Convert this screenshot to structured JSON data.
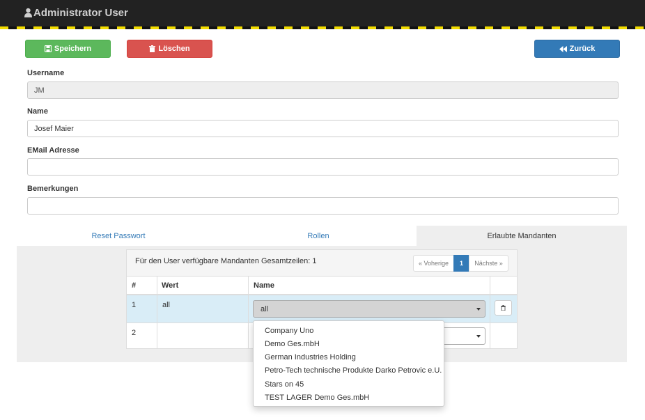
{
  "header": {
    "title": "Administrator User"
  },
  "toolbar": {
    "save_label": "Speichern",
    "delete_label": "Löschen",
    "back_label": "Zurück"
  },
  "form": {
    "username_label": "Username",
    "username_value": "JM",
    "name_label": "Name",
    "name_value": "Josef Maier",
    "email_label": "EMail Adresse",
    "email_value": "",
    "remarks_label": "Bemerkungen",
    "remarks_value": ""
  },
  "tabs": [
    {
      "label": "Reset Passwort",
      "active": false
    },
    {
      "label": "Rollen",
      "active": false
    },
    {
      "label": "Erlaubte Mandanten",
      "active": true
    }
  ],
  "mandanten": {
    "summary": "Für den User verfügbare Mandanten Gesamtzeilen: 1",
    "pager": {
      "prev": "« Voherige",
      "current": "1",
      "next": "Nächste »"
    },
    "columns": [
      "#",
      "Wert",
      "Name"
    ],
    "rows": [
      {
        "num": "1",
        "wert": "all",
        "name": "all"
      },
      {
        "num": "2",
        "wert": "",
        "name": ""
      }
    ],
    "dropdown_options": [
      "Company Uno",
      "Demo Ges.mbH",
      "German Industries Holding",
      "Petro-Tech technische Produkte Darko Petrovic e.U.",
      "Stars on 45",
      "TEST LAGER Demo Ges.mbH"
    ]
  },
  "colors": {
    "save": "#5cb85c",
    "delete": "#d9534f",
    "back": "#337ab7",
    "header_bg": "#222222",
    "stripe": "#f2dc00"
  }
}
